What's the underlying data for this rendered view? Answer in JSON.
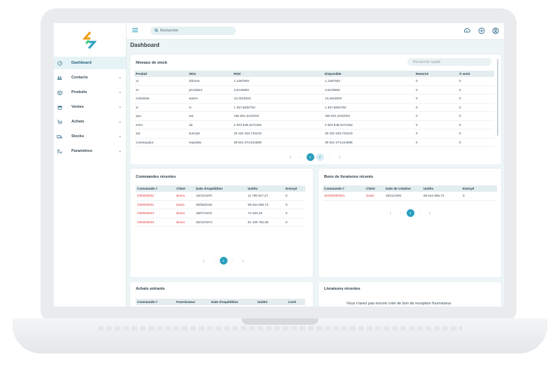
{
  "search": {
    "placeholder": "Rechercher"
  },
  "page": {
    "title": "Dashboard"
  },
  "sidebar": {
    "items": [
      {
        "label": "Dashboard",
        "icon": "speedometer-icon",
        "active": true
      },
      {
        "label": "Contacts",
        "icon": "people-icon"
      },
      {
        "label": "Produits",
        "icon": "box-icon"
      },
      {
        "label": "Ventes",
        "icon": "store-icon"
      },
      {
        "label": "Achats",
        "icon": "cart-icon"
      },
      {
        "label": "Stocks",
        "icon": "truck-icon"
      },
      {
        "label": "Paramètres",
        "icon": "user-settings-icon"
      }
    ]
  },
  "stock": {
    "title": "Niveaux de stock",
    "quick_search": "Recherche rapide",
    "columns": [
      "Produit",
      "SKU",
      "Réel",
      "Disponible",
      "Reservé",
      "À venir"
    ],
    "rows": [
      [
        "ut",
        "dolores",
        "1,1367063",
        "1,1367063",
        "0",
        "0"
      ],
      [
        "et",
        "provident",
        "3,5125963",
        "3,5125963",
        "0",
        "0"
      ],
      [
        "molestias",
        "autem",
        "13,4516534",
        "13,4516534",
        "0",
        "0"
      ],
      [
        "in",
        "in",
        "1 467,6602792",
        "1 467,6602792",
        "0",
        "0"
      ],
      [
        "quo",
        "aut",
        "165 501,4242018",
        "165 501,4242018",
        "0",
        "0"
      ],
      [
        "enim",
        "ab",
        "4 003 848,2471353",
        "4 003 848,2471353",
        "0",
        "0"
      ],
      [
        "aut",
        "suscipit",
        "28 431 818,723443",
        "28 431 818,723443",
        "0",
        "0"
      ],
      [
        "consequatur",
        "expedita",
        "39 841 574,644668",
        "39 841 574,644668",
        "0",
        "0"
      ]
    ],
    "pages": [
      "1",
      "2"
    ]
  },
  "orders": {
    "title": "Commandes récentes",
    "columns": [
      "Commande #",
      "Client",
      "Date d'expédition",
      "Unités",
      "Envoyé"
    ],
    "rows": [
      [
        "O00000002",
        "Bruen",
        "15/10/1970",
        "11 796 917,27",
        "0"
      ],
      [
        "O00000001",
        "Davis",
        "05/08/2019",
        "89 544 659,74",
        "0"
      ],
      [
        "O00000004",
        "Bruen",
        "29/07/1972",
        "74 340,19",
        "0"
      ],
      [
        "O00000003",
        "Bruen",
        "25/10/1974",
        "51 435 762,98",
        "0"
      ]
    ],
    "pages": [
      "1"
    ]
  },
  "deliveries": {
    "title": "Bons de livraisons récents",
    "columns": [
      "Commande #",
      "Client",
      "Date de création",
      "Unités",
      "Envoyé"
    ],
    "rows": [
      [
        "SH000000001",
        "Davis",
        "26/11/1991",
        "89 544 659,74",
        "0"
      ]
    ],
    "pages": [
      "1"
    ]
  },
  "incoming": {
    "title": "Achats entrants",
    "columns": [
      "Commande #",
      "Fournisseur",
      "Date d'expédition",
      "Unités",
      "Livré"
    ]
  },
  "recent_receipts": {
    "title": "Livraisons récentes",
    "empty": "Vous n'avez pas encore créé de bon de reception fournisseur."
  },
  "pager_icons": {
    "first": "|‹",
    "prev": "‹",
    "next": "›",
    "last": "›|"
  },
  "colors": {
    "accent": "#2a9fbd",
    "link_red": "#e0393b",
    "header_bg": "#e3edf0"
  }
}
